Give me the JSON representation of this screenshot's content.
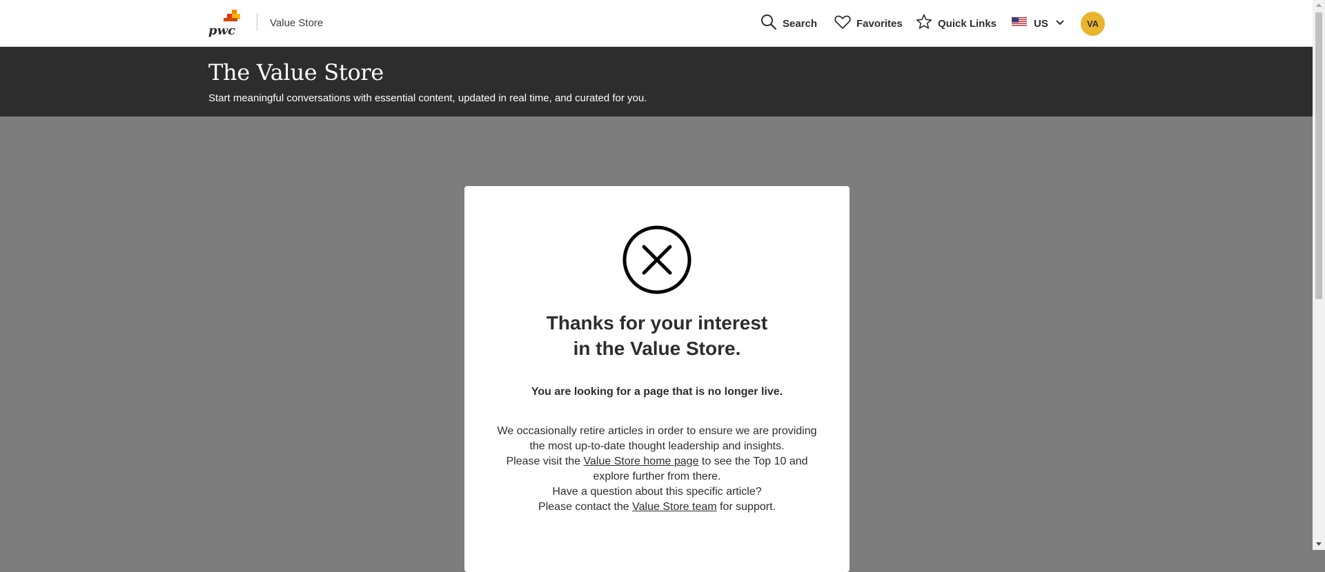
{
  "header": {
    "logo_text": "pwc",
    "app_name": "Value Store",
    "nav": {
      "search_label": "Search",
      "favorites_label": "Favorites",
      "quick_links_label": "Quick Links",
      "region_label": "US"
    },
    "avatar_initials": "VA",
    "avatar_color": "#ebb52b"
  },
  "hero": {
    "title": "The Value Store",
    "subtitle": "Start meaningful conversations with essential content, updated in real time, and curated for you."
  },
  "card": {
    "icon": "circle-x-icon",
    "title_line1": "Thanks for your interest",
    "title_line2": "in the Value Store.",
    "lead": "You are looking for a page that is no longer live.",
    "p1": "We occasionally retire articles in order to ensure we are providing the most up-to-date thought leadership and insights.",
    "p2_before": "Please visit the ",
    "p2_link": "Value Store home page",
    "p2_after": " to see the Top 10 and explore further from there.",
    "p3_line1": "Have a question about this specific article?",
    "p3_before": "Please contact the ",
    "p3_link": "Value Store team",
    "p3_after": " for support."
  },
  "colors": {
    "hero_bg": "#2d2d2d",
    "page_overlay": "#7d7d7d",
    "brand_orange": "#e0301e",
    "brand_amber": "#eb8c00"
  }
}
